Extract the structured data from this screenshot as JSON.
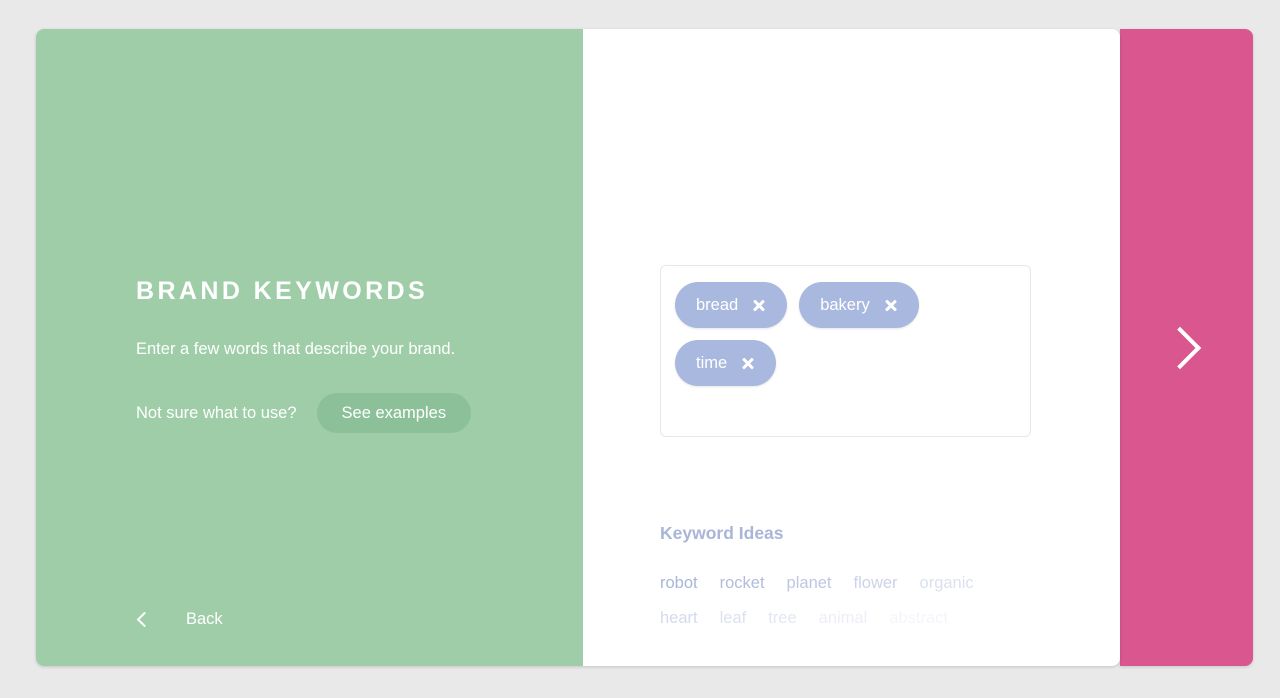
{
  "theme": {
    "page_background": "#e9e9e9",
    "left_panel": "#9ecda8",
    "next_panel": "#d9578e",
    "chip_background": "#a9b8de",
    "idea_text": "#a9b6d8",
    "card_background": "#ffffff"
  },
  "left": {
    "title": "BRAND KEYWORDS",
    "subtitle": "Enter a few words that describe your brand.",
    "examples_question": "Not sure what to use?",
    "see_examples_label": "See examples",
    "back_label": "Back",
    "back_icon": "chevron-left-icon"
  },
  "right": {
    "input": {
      "placeholder": "",
      "chips": [
        {
          "label": "bread",
          "remove_icon": "close-icon"
        },
        {
          "label": "bakery",
          "remove_icon": "close-icon"
        },
        {
          "label": "time",
          "remove_icon": "close-icon"
        }
      ]
    },
    "ideas": {
      "heading": "Keyword Ideas",
      "rows": [
        [
          {
            "label": "robot",
            "opacity": 1.0
          },
          {
            "label": "rocket",
            "opacity": 0.9
          },
          {
            "label": "planet",
            "opacity": 0.76
          },
          {
            "label": "flower",
            "opacity": 0.6
          },
          {
            "label": "organic",
            "opacity": 0.42
          }
        ],
        [
          {
            "label": "heart",
            "opacity": 0.5
          },
          {
            "label": "leaf",
            "opacity": 0.4
          },
          {
            "label": "tree",
            "opacity": 0.33
          },
          {
            "label": "animal",
            "opacity": 0.22
          },
          {
            "label": "abstract",
            "opacity": 0.13
          }
        ]
      ]
    }
  },
  "next": {
    "icon": "chevron-right-icon"
  }
}
